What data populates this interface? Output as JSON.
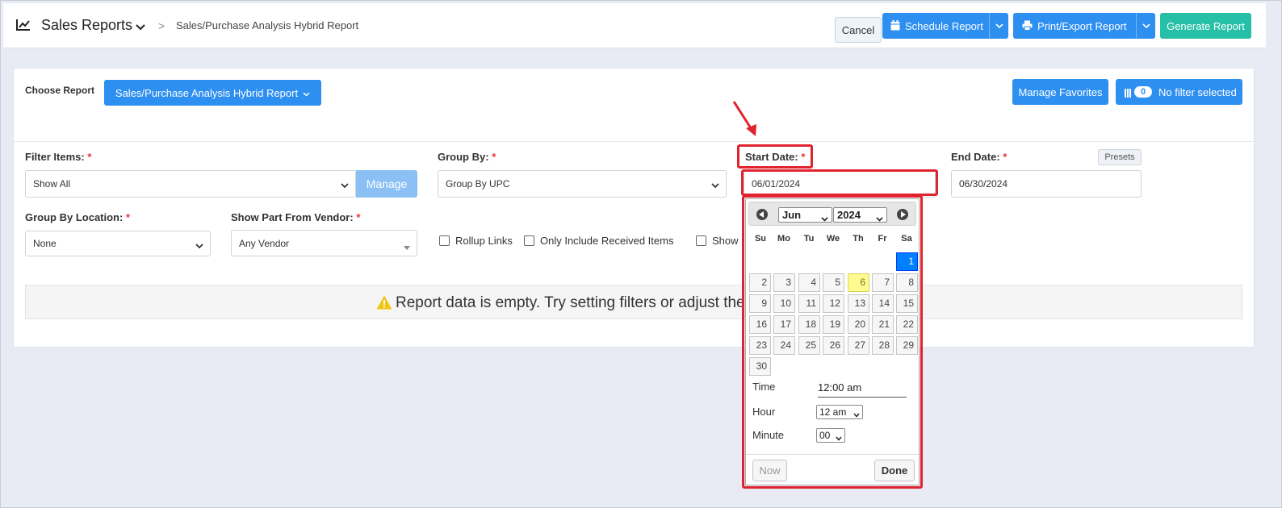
{
  "header": {
    "title": "Sales Reports",
    "breadcrumb_sep": ">",
    "breadcrumb": "Sales/Purchase Analysis Hybrid Report",
    "cancel_label": "Cancel",
    "schedule_label": "Schedule Report",
    "print_label": "Print/Export Report",
    "generate_label": "Generate Report"
  },
  "report": {
    "choose_label": "Choose Report",
    "selected_report": "Sales/Purchase Analysis Hybrid Report",
    "manage_favorites_label": "Manage Favorites",
    "filter_count": "0",
    "filter_label": "No filter selected"
  },
  "filters": {
    "filter_items_label": "Filter Items:",
    "filter_items_value": "Show All",
    "manage_label": "Manage",
    "group_by_label": "Group By:",
    "group_by_value": "Group By UPC",
    "start_date_label": "Start Date:",
    "start_date_value": "06/01/2024",
    "end_date_label": "End Date:",
    "end_date_value": "06/30/2024",
    "presets_label": "Presets",
    "group_by_location_label": "Group By Location:",
    "group_by_location_value": "None",
    "show_part_vendor_label": "Show Part From Vendor:",
    "show_part_vendor_value": "Any Vendor",
    "rollup_links_label": "Rollup Links",
    "only_received_label": "Only Include Received Items",
    "show_partial_label": "Show I",
    "required_mark": "*"
  },
  "empty_message": "Report data is empty. Try setting filters or adjust the",
  "datepicker": {
    "month": "Jun",
    "year": "2024",
    "weekdays": [
      "Su",
      "Mo",
      "Tu",
      "We",
      "Th",
      "Fr",
      "Sa"
    ],
    "days": [
      "1",
      "2",
      "3",
      "4",
      "5",
      "6",
      "7",
      "8",
      "9",
      "10",
      "11",
      "12",
      "13",
      "14",
      "15",
      "16",
      "17",
      "18",
      "19",
      "20",
      "21",
      "22",
      "23",
      "24",
      "25",
      "26",
      "27",
      "28",
      "29",
      "30"
    ],
    "first_weekday": 6,
    "today": "6",
    "selected": "1",
    "time_label": "Time",
    "time_value": "12:00 am",
    "hour_label": "Hour",
    "hour_value": "12 am",
    "minute_label": "Minute",
    "minute_value": "00",
    "now_label": "Now",
    "done_label": "Done"
  },
  "colors": {
    "primary": "#2d8ff0",
    "teal": "#26c0a8",
    "highlight": "#e0242f",
    "today": "#fffa90",
    "selected": "#007fff"
  }
}
